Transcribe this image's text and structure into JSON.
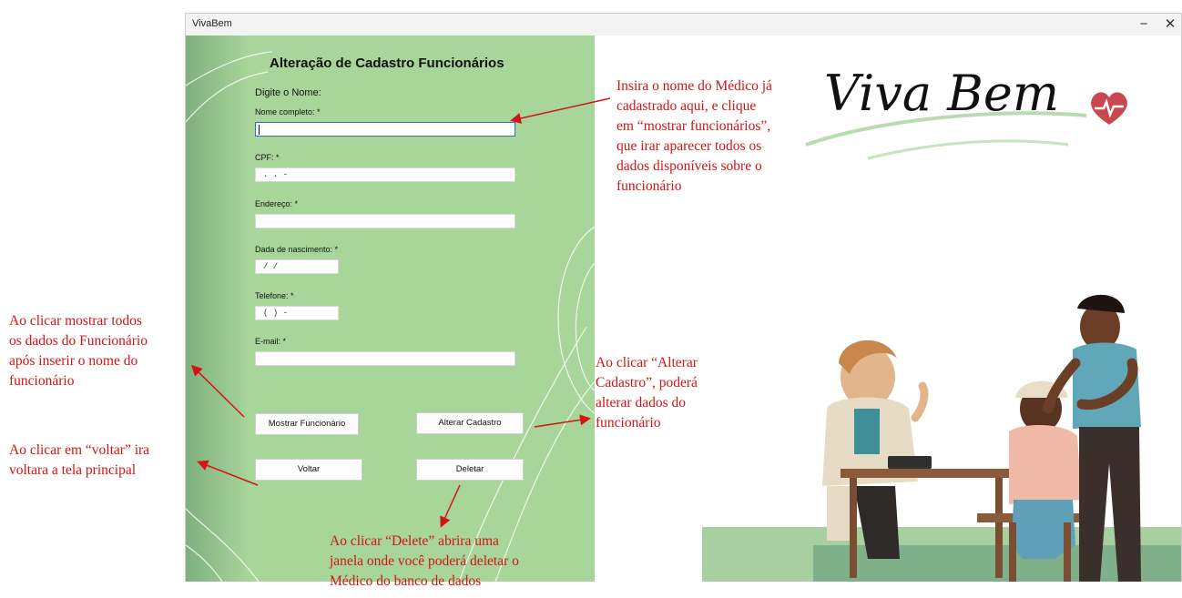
{
  "window": {
    "title": "VivaBem",
    "minimize_glyph": "−",
    "close_glyph": "✕"
  },
  "form": {
    "title": "Alteração de Cadastro Funcionários",
    "prompt": "Digite o Nome:",
    "fields": {
      "nome": {
        "label": "Nome completo: *",
        "value": ""
      },
      "cpf": {
        "label": "CPF: *",
        "mask": " .  .  -"
      },
      "endereco": {
        "label": "Endereço: *",
        "value": ""
      },
      "nascimento": {
        "label": "Dada de nascimento: *",
        "mask": "/ /"
      },
      "telefone": {
        "label": "Telefone: *",
        "mask": "(  )      -"
      },
      "email": {
        "label": "E-mail: *",
        "value": ""
      }
    },
    "buttons": {
      "mostrar": "Mostrar Funcionário",
      "alterar": "Alterar Cadastro",
      "voltar": "Voltar",
      "deletar": "Deletar"
    }
  },
  "branding": {
    "logo_text": "Viva Bem",
    "logo_icon": "heart-pulse-icon",
    "illustration": "doctor-patient-illustration"
  },
  "annotations": {
    "nome_hint": [
      "Insira o nome do Médico já",
      "cadastrado aqui, e clique",
      "em “mostrar funcionários”,",
      "que irar aparecer todos os",
      "dados disponíveis sobre o",
      "funcionário"
    ],
    "mostrar_hint": [
      "Ao clicar mostrar todos",
      "os dados do Funcionário",
      "após inserir o nome do",
      "funcionário"
    ],
    "voltar_hint": [
      "Ao clicar em “voltar” ira",
      "voltara a tela principal"
    ],
    "alterar_hint": [
      "Ao clicar “Alterar",
      "Cadastro”, poderá",
      "alterar dados do",
      "funcionário"
    ],
    "deletar_hint": [
      "Ao clicar “Delete” abrira uma",
      "janela onde você poderá deletar o",
      "Médico do banco de dados"
    ]
  },
  "colors": {
    "form_bg": "#a8d59a",
    "annotation": "#d11414",
    "logo_heart": "#c9474f"
  }
}
